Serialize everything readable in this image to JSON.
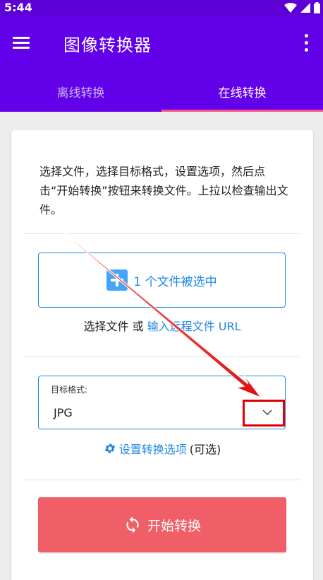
{
  "status_bar": {
    "time": "5:44"
  },
  "app_bar": {
    "title": "图像转换器"
  },
  "tabs": [
    {
      "label": "离线转换",
      "active": false
    },
    {
      "label": "在线转换",
      "active": true
    }
  ],
  "card": {
    "instructions": "选择文件，选择目标格式，设置选项，然后点击“开始转换”按钮来转换文件。上拉以检查输出文件。",
    "file_selected_label": "1 个文件被选中",
    "choose_file_text": "选择文件 或 ",
    "remote_url_link": "输入远程文件 URL",
    "target_format_label": "目标格式:",
    "target_format_value": "JPG",
    "options_link": "设置转换选项",
    "options_suffix": " (可选)",
    "start_button_label": "开始转换"
  },
  "colors": {
    "app_bar": "#6200ea",
    "tab_indicator": "#ff4f8b",
    "link_blue": "#1e88e5",
    "start_button": "#f05f67",
    "annotation_red": "#e00000"
  },
  "icons": [
    "menu-icon",
    "more-vert-icon",
    "plus-icon",
    "chevron-down-icon",
    "gear-icon",
    "sync-icon",
    "wifi-icon",
    "battery-icon"
  ]
}
